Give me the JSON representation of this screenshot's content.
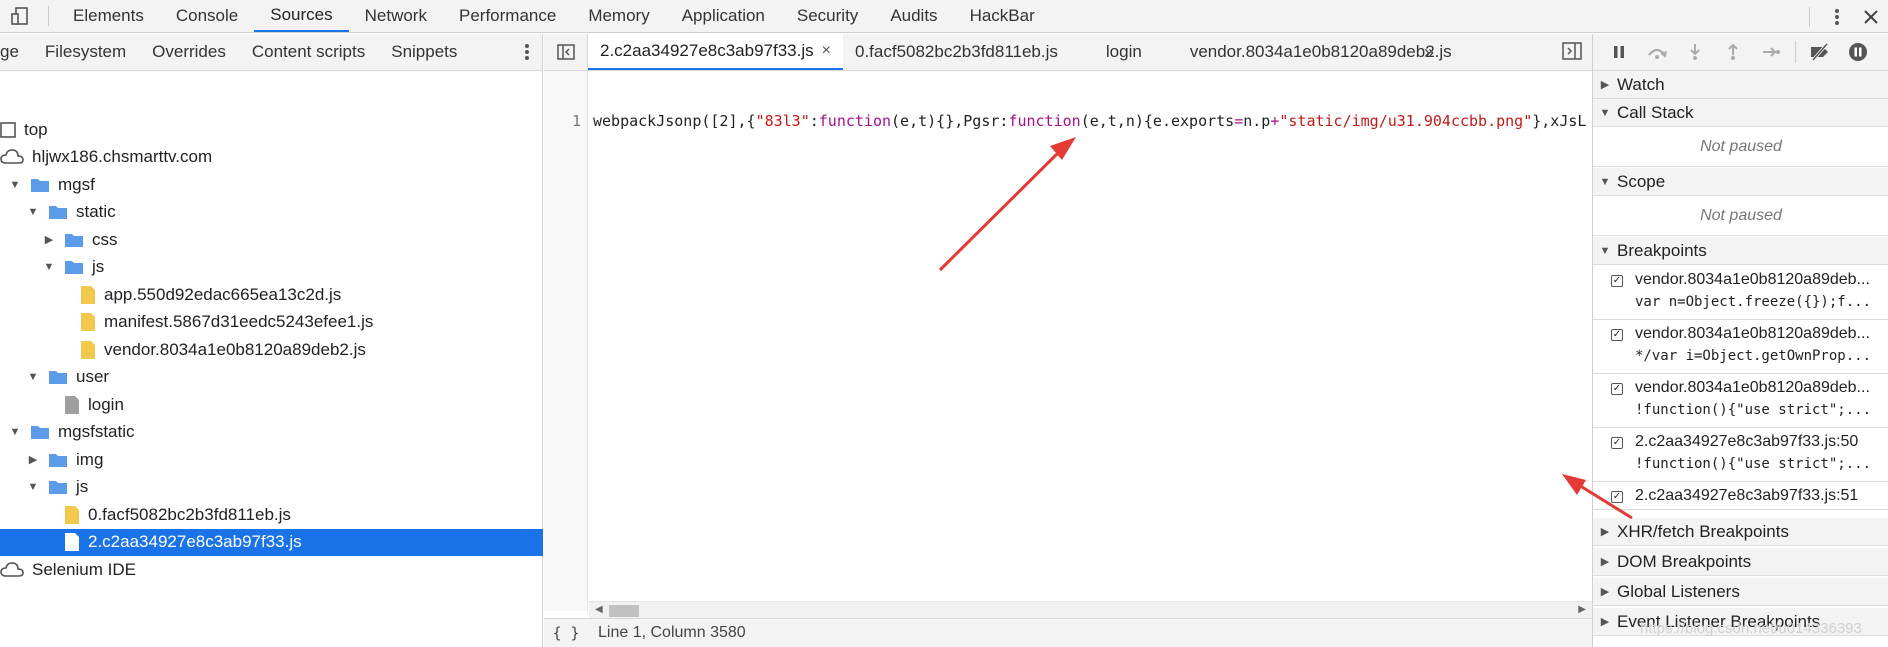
{
  "topbar": {
    "tabs": [
      "Elements",
      "Console",
      "Sources",
      "Network",
      "Performance",
      "Memory",
      "Application",
      "Security",
      "Audits",
      "HackBar"
    ],
    "active_tab": "Sources"
  },
  "navigator": {
    "tabs": [
      "ge",
      "Filesystem",
      "Overrides",
      "Content scripts",
      "Snippets"
    ],
    "tree": [
      {
        "label": "top",
        "depth": 0,
        "icon": "frame-icon",
        "expanded": null
      },
      {
        "label": "hljwx186.chsmarttv.com",
        "depth": 0,
        "icon": "cloud-icon",
        "expanded": null
      },
      {
        "label": "mgsf",
        "depth": 0,
        "icon": "folder-icon",
        "expanded": true
      },
      {
        "label": "static",
        "depth": 1,
        "icon": "folder-icon",
        "expanded": true
      },
      {
        "label": "css",
        "depth": 2,
        "icon": "folder-icon",
        "expanded": false
      },
      {
        "label": "js",
        "depth": 2,
        "icon": "folder-icon",
        "expanded": true
      },
      {
        "label": "app.550d92edac665ea13c2d.js",
        "depth": 3,
        "icon": "js-file-icon",
        "expanded": null
      },
      {
        "label": "manifest.5867d31eedc5243efee1.js",
        "depth": 3,
        "icon": "js-file-icon",
        "expanded": null
      },
      {
        "label": "vendor.8034a1e0b8120a89deb2.js",
        "depth": 3,
        "icon": "js-file-icon",
        "expanded": null
      },
      {
        "label": "user",
        "depth": 1,
        "icon": "folder-icon",
        "expanded": true
      },
      {
        "label": "login",
        "depth": 2,
        "icon": "document-file-icon",
        "expanded": null
      },
      {
        "label": "mgsfstatic",
        "depth": 0,
        "icon": "folder-icon",
        "expanded": true
      },
      {
        "label": "img",
        "depth": 1,
        "icon": "folder-icon",
        "expanded": false
      },
      {
        "label": "js",
        "depth": 1,
        "icon": "folder-icon",
        "expanded": true
      },
      {
        "label": "0.facf5082bc2b3fd811eb.js",
        "depth": 2,
        "icon": "js-file-icon",
        "expanded": null
      },
      {
        "label": "2.c2aa34927e8c3ab97f33.js",
        "depth": 2,
        "icon": "js-file-icon",
        "expanded": null,
        "selected": true
      },
      {
        "label": "Selenium IDE",
        "depth": 0,
        "icon": "cloud-icon",
        "expanded": null
      }
    ]
  },
  "editor": {
    "tabs": [
      {
        "label": "2.c2aa34927e8c3ab97f33.js",
        "active": true,
        "closable": true
      },
      {
        "label": "0.facf5082bc2b3fd811eb.js",
        "active": false
      },
      {
        "label": "login",
        "active": false
      },
      {
        "label": "vendor.8034a1e0b8120a89deb2.js",
        "active": false
      }
    ],
    "more_tabs": "»",
    "line_number": "1",
    "code_tokens": [
      {
        "t": "webpackJsonp([2],{",
        "c": "plain"
      },
      {
        "t": "\"83l3\"",
        "c": "str"
      },
      {
        "t": ":",
        "c": "plain"
      },
      {
        "t": "function",
        "c": "kw"
      },
      {
        "t": "(e,t){},Pgsr:",
        "c": "plain"
      },
      {
        "t": "function",
        "c": "kw"
      },
      {
        "t": "(e,t,n){e.exports",
        "c": "plain"
      },
      {
        "t": "=",
        "c": "kw"
      },
      {
        "t": "n.p",
        "c": "plain"
      },
      {
        "t": "+",
        "c": "kw"
      },
      {
        "t": "\"static/img/u31.904ccbb.png\"",
        "c": "str"
      },
      {
        "t": "},xJsL",
        "c": "plain"
      }
    ],
    "status": {
      "braces": "{ }",
      "position": "Line 1, Column 3580"
    }
  },
  "debugger": {
    "sections": {
      "watch": "Watch",
      "call_stack": "Call Stack",
      "scope": "Scope",
      "breakpoints": "Breakpoints",
      "xhr": "XHR/fetch Breakpoints",
      "dom": "DOM Breakpoints",
      "global": "Global Listeners",
      "event": "Event Listener Breakpoints"
    },
    "not_paused": "Not paused",
    "breakpoints": [
      {
        "file": "vendor.8034a1e0b8120a89deb...",
        "snippet": "var n=Object.freeze({});f..."
      },
      {
        "file": "vendor.8034a1e0b8120a89deb...",
        "snippet": "*/var i=Object.getOwnProp..."
      },
      {
        "file": "vendor.8034a1e0b8120a89deb...",
        "snippet": "!function(){\"use strict\";..."
      },
      {
        "file": "2.c2aa34927e8c3ab97f33.js:50",
        "snippet": "!function(){\"use strict\";..."
      },
      {
        "file": "2.c2aa34927e8c3ab97f33.js:51",
        "snippet": ""
      }
    ],
    "watermark": "https://blog.csdn.net/u014336393"
  },
  "colors": {
    "accent": "#1a73e8",
    "annotation_arrow": "#e53935"
  }
}
